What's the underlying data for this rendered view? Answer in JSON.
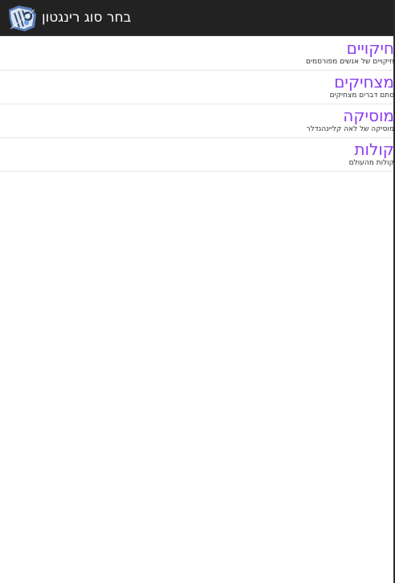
{
  "action_bar": {
    "title": "בחר סוג רינגטון",
    "icon": "app-icon"
  },
  "list": {
    "items": [
      {
        "title": "חיקויים",
        "subtitle": "חיקויים של אנשים מפורסמים"
      },
      {
        "title": "מצחיקים",
        "subtitle": "סתם דברים מצחיקים"
      },
      {
        "title": "מוסיקה",
        "subtitle": "מוסיקה של לאה קליינהנדלר"
      },
      {
        "title": "קולות",
        "subtitle": "קולות מהעולם"
      }
    ]
  },
  "colors": {
    "action_bar_bg": "#222222",
    "title_text": "#ffffff",
    "item_title": "#8a3cf0",
    "item_subtitle": "#333333",
    "divider": "#e6e6e6"
  }
}
